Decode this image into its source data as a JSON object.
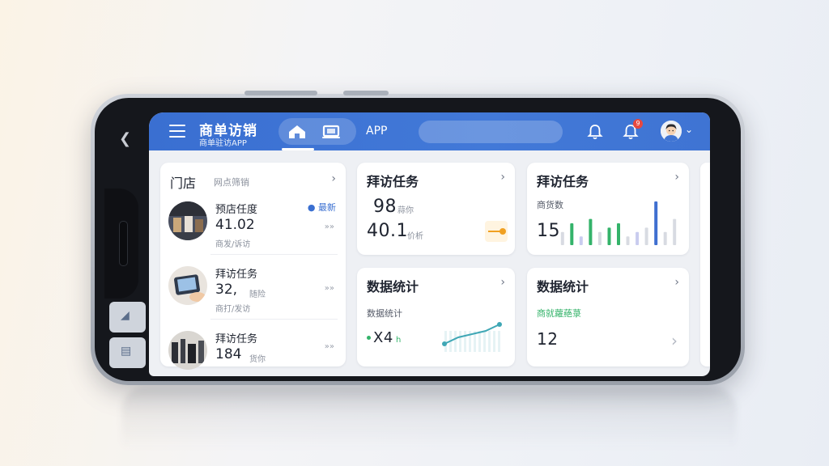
{
  "header": {
    "title": "商单访销",
    "subtitle": "商单驻访APP",
    "app_label": "APP",
    "notification_badge": "9"
  },
  "store_panel": {
    "title": "门店",
    "filter": "网点筛销",
    "new_label": "● 最新",
    "items": [
      {
        "name": "预店任度",
        "value": "41.02",
        "sub": "商发/诉访",
        "arrow": "»»"
      },
      {
        "name": "拜访任务",
        "value": "32,",
        "sub": "商打/发访",
        "extra": "随险",
        "arrow": "»»"
      },
      {
        "name": "拜访任务",
        "value": "184",
        "sub": "",
        "extra": "货你",
        "arrow": "»»"
      }
    ]
  },
  "task_card_1": {
    "title": "拜访任务",
    "value1": "98",
    "unit1": "蒜你",
    "value2": "40.1",
    "unit2": "价析"
  },
  "task_card_2": {
    "title": "拜访任务",
    "label": "商货数",
    "value": "15"
  },
  "stats_card_1": {
    "title": "数据统计",
    "label": "数据统计",
    "value": "X4",
    "suffix": "h"
  },
  "stats_card_2": {
    "title": "数据统计",
    "label": "商就蘿蕝菉",
    "value": "12"
  },
  "colors": {
    "header_blue": "#3f74d3",
    "accent_green": "#34b36a",
    "accent_teal": "#3fa7b5",
    "accent_orange": "#f0a021",
    "badge_red": "#e8483f"
  },
  "chart_data": {
    "type": "bar",
    "categories": [
      "1",
      "2",
      "3",
      "4",
      "5",
      "6",
      "7",
      "8",
      "9",
      "10",
      "11",
      "12",
      "13"
    ],
    "values": [
      3,
      5,
      2,
      6,
      3,
      4,
      5,
      2,
      3,
      4,
      10,
      3,
      6
    ],
    "colors": [
      "#d8dbe2",
      "#34b36a",
      "#c9ccef",
      "#34b36a",
      "#d8dbe2",
      "#34b36a",
      "#34b36a",
      "#d8dbe2",
      "#c9ccef",
      "#d8dbe2",
      "#3f6fd0",
      "#d8dbe2",
      "#d8dbe2"
    ]
  },
  "line_chart": {
    "type": "line",
    "x": [
      1,
      2,
      3,
      4,
      5
    ],
    "values": [
      1,
      2,
      2.5,
      3,
      4
    ]
  }
}
